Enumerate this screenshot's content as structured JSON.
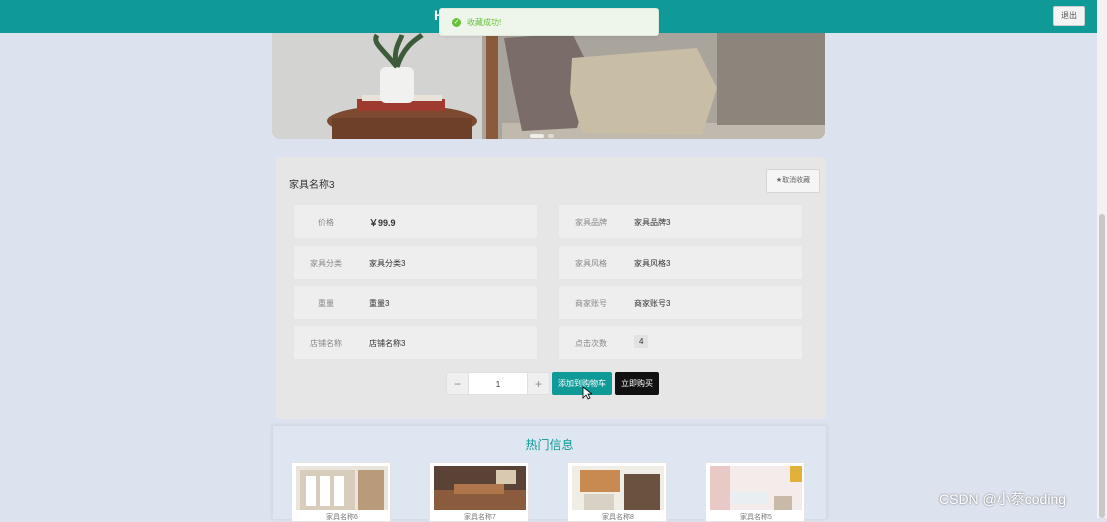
{
  "header": {
    "glyph": "H",
    "logout_label": "退出"
  },
  "toast": {
    "text": "收藏成功!"
  },
  "product": {
    "title": "家具名称3",
    "fav_button": "★取消收藏",
    "fields": [
      {
        "label": "价格",
        "value": "￥99.9"
      },
      {
        "label": "家具品牌",
        "value": "家具品牌3"
      },
      {
        "label": "家具分类",
        "value": "家具分类3"
      },
      {
        "label": "家具风格",
        "value": "家具风格3"
      },
      {
        "label": "重量",
        "value": "重量3"
      },
      {
        "label": "商家账号",
        "value": "商家账号3"
      },
      {
        "label": "店铺名称",
        "value": "店铺名称3"
      },
      {
        "label": "点击次数",
        "value": "4"
      }
    ],
    "quantity": {
      "minus": "−",
      "value": "1",
      "plus": "+"
    },
    "add_to_cart": "添加到购物车",
    "buy_now": "立即购买"
  },
  "hot": {
    "title": "热门信息",
    "items": [
      {
        "caption": "家具名称6"
      },
      {
        "caption": "家具名称7"
      },
      {
        "caption": "家具名称8"
      },
      {
        "caption": "家具名称5"
      }
    ]
  },
  "watermark": "CSDN @小蔡coding",
  "colors": {
    "accent": "#0f9a98",
    "success": "#67c23a",
    "dark_button": "#111111",
    "background": "#dde3ee"
  }
}
